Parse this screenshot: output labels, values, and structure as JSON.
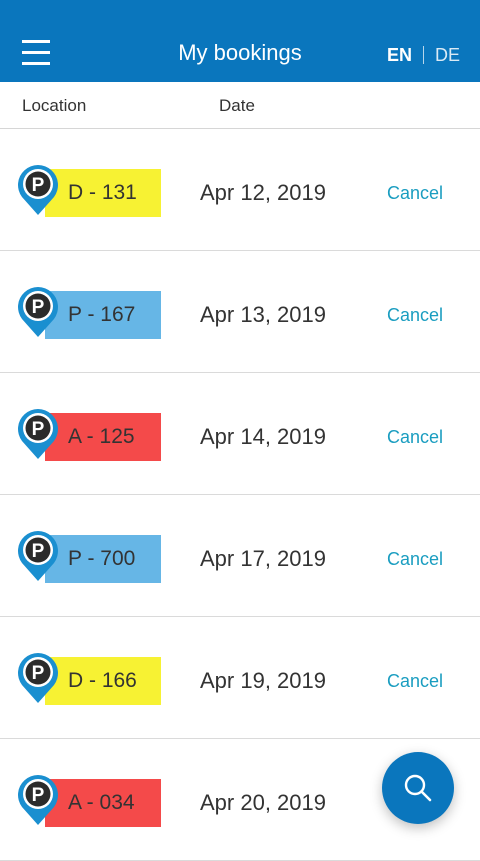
{
  "header": {
    "title": "My bookings",
    "lang_active": "EN",
    "lang_other": "DE",
    "menu_icon": "hamburger-menu-icon",
    "color": "#0a76bd"
  },
  "columns": {
    "location": "Location",
    "date": "Date"
  },
  "parking_icon_letter": "P",
  "bookings": [
    {
      "spot": "D - 131",
      "date": "Apr 12, 2019",
      "action": "Cancel",
      "tag_color": "#f7f233"
    },
    {
      "spot": "P - 167",
      "date": "Apr 13, 2019",
      "action": "Cancel",
      "tag_color": "#66b6e6"
    },
    {
      "spot": "A - 125",
      "date": "Apr 14, 2019",
      "action": "Cancel",
      "tag_color": "#f44a4a"
    },
    {
      "spot": "P - 700",
      "date": "Apr 17, 2019",
      "action": "Cancel",
      "tag_color": "#66b6e6"
    },
    {
      "spot": "D - 166",
      "date": "Apr 19, 2019",
      "action": "Cancel",
      "tag_color": "#f7f233"
    },
    {
      "spot": "A - 034",
      "date": "Apr 20, 2019",
      "action": "",
      "tag_color": "#f44a4a"
    }
  ],
  "fab": {
    "icon": "search-icon"
  }
}
